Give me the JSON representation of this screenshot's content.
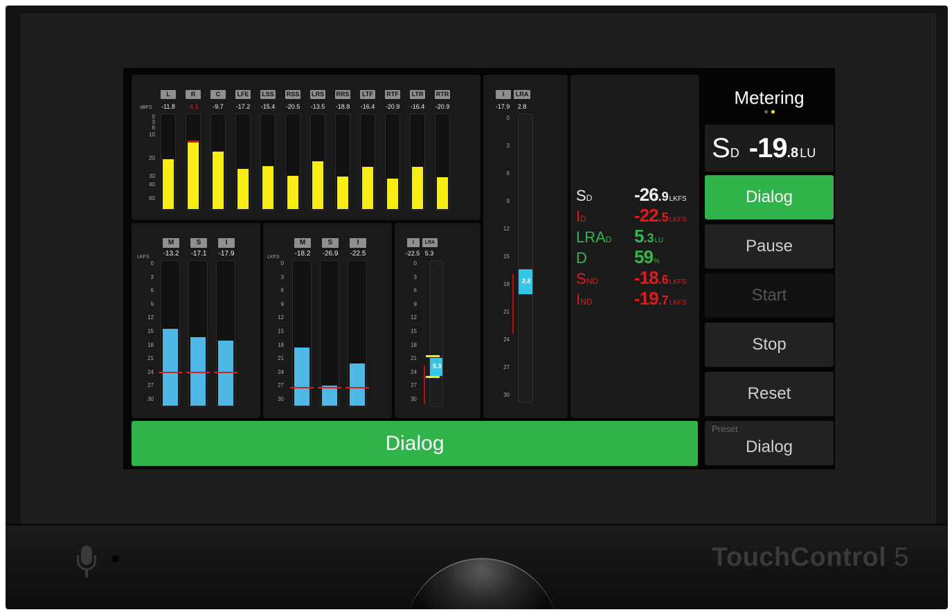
{
  "device": {
    "brand_bold": "TouchControl",
    "brand_num": "5"
  },
  "surround": {
    "unit": "dBFS",
    "channels": [
      "L",
      "R",
      "C",
      "LFE",
      "LSS",
      "RSS",
      "LRS",
      "RRS",
      "LTF",
      "RTF",
      "LTR",
      "RTR"
    ],
    "values": [
      "-11.8",
      "-4.1",
      "-9.7",
      "-17.2",
      "-15.4",
      "-20.5",
      "-13.5",
      "-18.8",
      "-16.4",
      "-20.9",
      "-16.4",
      "-20.9"
    ],
    "levels": [
      0.52,
      0.7,
      0.6,
      0.42,
      0.45,
      0.35,
      0.5,
      0.34,
      0.44,
      0.32,
      0.44,
      0.33
    ],
    "scale": [
      "0",
      "3",
      "6",
      "10",
      "20",
      "30",
      "40",
      "60"
    ]
  },
  "loud1": {
    "unit": "LKFS",
    "labels": [
      "M",
      "S",
      "I"
    ],
    "values": [
      "-13.2",
      "-17.1",
      "-17.9"
    ],
    "levels": [
      0.53,
      0.47,
      0.45
    ]
  },
  "loud2": {
    "unit": "LKFS",
    "labels": [
      "M",
      "S",
      "I"
    ],
    "values": [
      "-18.2",
      "-26.9",
      "-22.5"
    ],
    "levels": [
      0.4,
      0.14,
      0.29
    ]
  },
  "loud_scale": [
    "0",
    "3",
    "6",
    "9",
    "12",
    "15",
    "18",
    "21",
    "24",
    "27",
    "30"
  ],
  "lra_small": {
    "labels": [
      "I",
      "LRA"
    ],
    "values": [
      "-22.5",
      "5.3"
    ],
    "marker": "5.3"
  },
  "lra_big": {
    "labels": [
      "I",
      "LRA"
    ],
    "values": [
      "-17.9",
      "2.8"
    ],
    "marker": "2.8",
    "scale": [
      "0",
      "3",
      "6",
      "9",
      "12",
      "15",
      "18",
      "21",
      "24",
      "27",
      "30"
    ]
  },
  "readouts": [
    {
      "label": "S",
      "sub": "D",
      "value": "-26",
      "dec": ".9",
      "unit": "LKFS",
      "color": "white"
    },
    {
      "label": "I",
      "sub": "D",
      "value": "-22",
      "dec": ".5",
      "unit": "LKFS",
      "color": "red"
    },
    {
      "label": "LRA",
      "sub": "D",
      "value": "5",
      "dec": ".3",
      "unit": "LU",
      "color": "green"
    },
    {
      "label": "D",
      "sub": "",
      "value": "59",
      "dec": "",
      "unit": "%",
      "color": "green"
    },
    {
      "label": "S",
      "sub": "ND",
      "value": "-18",
      "dec": ".6",
      "unit": "LKFS",
      "color": "red"
    },
    {
      "label": "I",
      "sub": "ND",
      "value": "-19",
      "dec": ".7",
      "unit": "LKFS",
      "color": "red"
    }
  ],
  "sidebar": {
    "title": "Metering",
    "sd_label": "S",
    "sd_sub": "D",
    "sd_value": "-19",
    "sd_dec": ".8",
    "sd_unit": "LU",
    "buttons": [
      "Dialog",
      "Pause",
      "Start",
      "Stop",
      "Reset"
    ],
    "preset_label": "Preset",
    "preset_value": "Dialog"
  },
  "big_button": "Dialog",
  "colors": {
    "green": "#2fb34a",
    "yellow": "#f7ec13",
    "blue": "#50b8e6",
    "red": "#e11b1b"
  }
}
